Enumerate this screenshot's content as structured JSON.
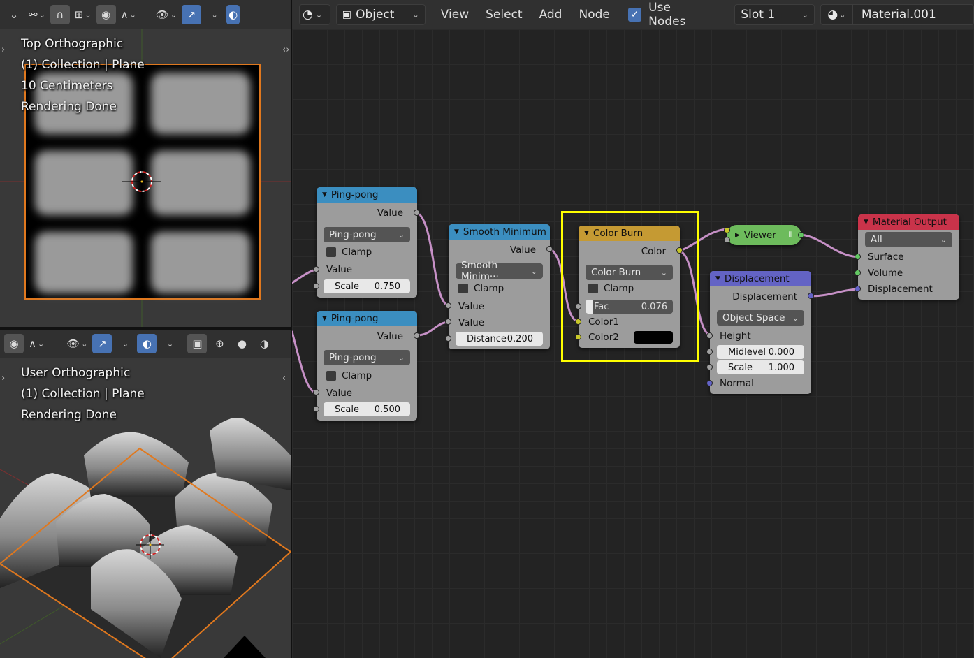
{
  "top_viewport": {
    "overlay": [
      "Top Orthographic",
      "(1) Collection | Plane",
      "10 Centimeters",
      "Rendering Done"
    ],
    "header_icons": [
      "view-chevron",
      "link-icon",
      "snap-magnet-icon",
      "grid-icon",
      "pivot-icon",
      "falloff-icon",
      "visibility-eye-icon",
      "gizmo-icon",
      "overlay-icon"
    ]
  },
  "bottom_viewport": {
    "overlay": [
      "User Orthographic",
      "(1) Collection | Plane",
      "Rendering Done"
    ]
  },
  "node_editor": {
    "header": {
      "mode": "Object",
      "menus": [
        "View",
        "Select",
        "Add",
        "Node"
      ],
      "use_nodes_label": "Use Nodes",
      "use_nodes_checked": true,
      "slot": "Slot 1",
      "material": "Material.001"
    },
    "nodes": {
      "pingpong1": {
        "title": "Ping-pong",
        "output": "Value",
        "mode": "Ping-pong",
        "clamp": "Clamp",
        "input": "Value",
        "field_label": "Scale",
        "field_value": "0.750"
      },
      "pingpong2": {
        "title": "Ping-pong",
        "output": "Value",
        "mode": "Ping-pong",
        "clamp": "Clamp",
        "input": "Value",
        "field_label": "Scale",
        "field_value": "0.500"
      },
      "smoothmin": {
        "title": "Smooth Minimum",
        "output": "Value",
        "mode": "Smooth Minim···",
        "clamp": "Clamp",
        "input1": "Value",
        "input2": "Value",
        "field_label": "Distance",
        "field_value": "0.200"
      },
      "colorburn": {
        "title": "Color Burn",
        "output": "Color",
        "mode": "Color Burn",
        "clamp": "Clamp",
        "fac_label": "Fac",
        "fac_value": "0.076",
        "fac_level": 0.076,
        "input1": "Color1",
        "input2": "Color2",
        "color2": "#000000"
      },
      "viewer": {
        "title": "Viewer"
      },
      "displacement": {
        "title": "Displacement",
        "output": "Displacement",
        "space": "Object Space",
        "height": "Height",
        "midlevel_label": "Midlevel",
        "midlevel_value": "0.000",
        "scale_label": "Scale",
        "scale_value": "1.000",
        "normal": "Normal"
      },
      "output": {
        "title": "Material Output",
        "target": "All",
        "surface": "Surface",
        "volume": "Volume",
        "displacement": "Displacement"
      }
    },
    "colors": {
      "converter_header": "#3b8ec0",
      "color_header": "#c59a33",
      "vector_header": "#6363c4",
      "output_header": "#c9334a",
      "viewer_body": "#6dbb5c",
      "selection_highlight": "#ffff00",
      "link": "#c690c6"
    }
  }
}
